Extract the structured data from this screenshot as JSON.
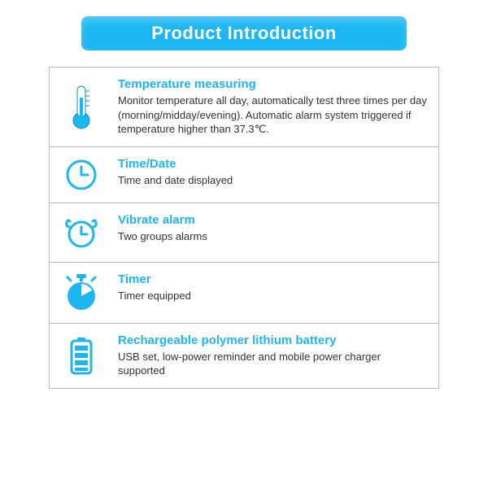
{
  "banner": "Product Introduction",
  "colors": {
    "accent": "#1cb7f2"
  },
  "features": [
    {
      "icon": "thermometer-icon",
      "title": "Temperature measuring",
      "desc": "Monitor temperature all day, automatically test three times per day (morning/midday/evening). Automatic alarm system triggered if temperature higher than 37.3℃."
    },
    {
      "icon": "clock-icon",
      "title": "Time/Date",
      "desc": "Time and date displayed"
    },
    {
      "icon": "alarm-icon",
      "title": "Vibrate alarm",
      "desc": "Two groups alarms"
    },
    {
      "icon": "stopwatch-icon",
      "title": "Timer",
      "desc": "Timer equipped"
    },
    {
      "icon": "battery-icon",
      "title": "Rechargeable polymer lithium battery",
      "desc": "USB set, low-power reminder and mobile power charger supported"
    }
  ]
}
